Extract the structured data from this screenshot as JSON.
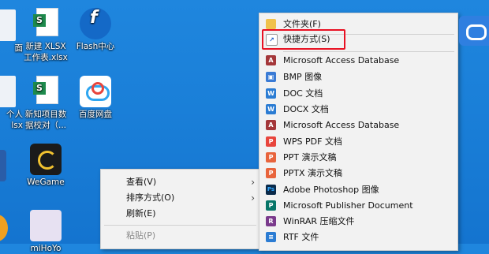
{
  "desktop": {
    "icons": [
      {
        "label": "面",
        "name": "desktop-icon-cut-1"
      },
      {
        "label": "新建 XLSX\n工作表.xlsx",
        "name": "desktop-icon-xlsx-new"
      },
      {
        "label": "Flash中心",
        "name": "desktop-icon-flash"
      },
      {
        "label": "个人\nlsx",
        "name": "desktop-icon-cut-2"
      },
      {
        "label": "新知项目数\n据校对（...",
        "name": "desktop-icon-xlsx-project"
      },
      {
        "label": "百度网盘",
        "name": "desktop-icon-baidu"
      },
      {
        "label": "WeGame",
        "name": "desktop-icon-wegame"
      },
      {
        "label": "miHoYo",
        "name": "desktop-icon-mihoyo"
      }
    ],
    "xlsx_glyph": "S"
  },
  "context_menu": {
    "items": [
      {
        "label": "查看(V)",
        "has_submenu": true
      },
      {
        "label": "排序方式(O)",
        "has_submenu": true
      },
      {
        "label": "刷新(E)",
        "has_submenu": false
      },
      {
        "label": "粘贴(P)",
        "has_submenu": false,
        "disabled": true
      }
    ]
  },
  "new_submenu": {
    "items": [
      {
        "label": "文件夹(F)",
        "icon": "folder-icon",
        "color": "#f0c24b",
        "glyph": ""
      },
      {
        "label": "快捷方式(S)",
        "icon": "shortcut-icon",
        "color": "#1c5ec9",
        "glyph": "↗",
        "highlighted": true
      },
      {
        "label": "Microsoft Access Database",
        "icon": "access-icon",
        "color": "#a4373a",
        "glyph": "A"
      },
      {
        "label": "BMP 图像",
        "icon": "bmp-icon",
        "color": "#3a7bd5",
        "glyph": "▣"
      },
      {
        "label": "DOC 文档",
        "icon": "doc-icon",
        "color": "#2b7cd3",
        "glyph": "W"
      },
      {
        "label": "DOCX 文档",
        "icon": "docx-icon",
        "color": "#2b7cd3",
        "glyph": "W"
      },
      {
        "label": "Microsoft Access Database",
        "icon": "access-icon",
        "color": "#a4373a",
        "glyph": "A"
      },
      {
        "label": "WPS PDF 文档",
        "icon": "wps-pdf-icon",
        "color": "#e8453c",
        "glyph": "P"
      },
      {
        "label": "PPT 演示文稿",
        "icon": "ppt-icon",
        "color": "#e8643c",
        "glyph": "P"
      },
      {
        "label": "PPTX 演示文稿",
        "icon": "pptx-icon",
        "color": "#e8643c",
        "glyph": "P"
      },
      {
        "label": "Adobe Photoshop 图像",
        "icon": "photoshop-icon",
        "color": "#0a2a4a",
        "glyph": "Ps"
      },
      {
        "label": "Microsoft Publisher Document",
        "icon": "publisher-icon",
        "color": "#077568",
        "glyph": "P"
      },
      {
        "label": "WinRAR 压缩文件",
        "icon": "winrar-icon",
        "color": "#7a3a8c",
        "glyph": "R"
      },
      {
        "label": "RTF 文件",
        "icon": "rtf-icon",
        "color": "#2b7cd3",
        "glyph": "≡"
      }
    ],
    "highlight_color": "#e81123"
  },
  "tray": {
    "icon": "baidu-cloud-icon"
  }
}
